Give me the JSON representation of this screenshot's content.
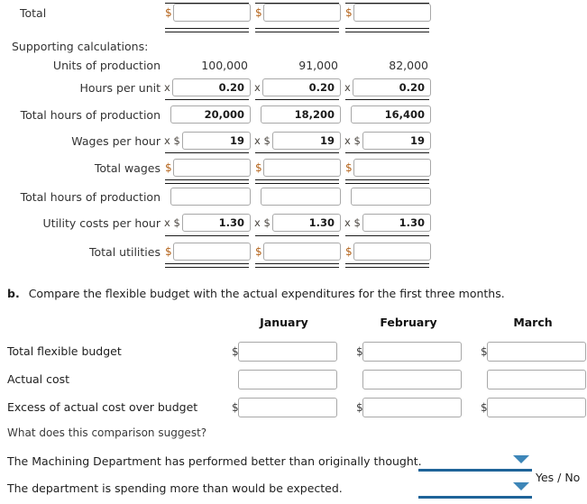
{
  "section_a": {
    "rows": [
      {
        "label": "Total",
        "label_style": "total",
        "cells": [
          {
            "type": "input",
            "prefix": "$",
            "value": ""
          },
          {
            "type": "input",
            "prefix": "$",
            "value": ""
          },
          {
            "type": "input",
            "prefix": "$",
            "value": ""
          }
        ]
      },
      {
        "label": "Supporting calculations:",
        "label_style": "section",
        "cells": [
          {
            "type": "empty"
          },
          {
            "type": "empty"
          },
          {
            "type": "empty"
          }
        ]
      },
      {
        "label": "Units of production",
        "label_style": "indent",
        "cells": [
          {
            "type": "text",
            "value": "100,000"
          },
          {
            "type": "text",
            "value": "91,000"
          },
          {
            "type": "text",
            "value": "82,000"
          }
        ]
      },
      {
        "label": "Hours per unit",
        "label_style": "indent",
        "cells": [
          {
            "type": "input",
            "prefix": "x",
            "value": "0.20"
          },
          {
            "type": "input",
            "prefix": "x",
            "value": "0.20"
          },
          {
            "type": "input",
            "prefix": "x",
            "value": "0.20"
          }
        ]
      },
      {
        "label": "Total hours of production",
        "label_style": "indent",
        "cells": [
          {
            "type": "input",
            "prefix": "",
            "value": "20,000"
          },
          {
            "type": "input",
            "prefix": "",
            "value": "18,200"
          },
          {
            "type": "input",
            "prefix": "",
            "value": "16,400"
          }
        ]
      },
      {
        "label": "Wages per hour",
        "label_style": "indent",
        "cells": [
          {
            "type": "input",
            "prefix": "x $",
            "value": "19"
          },
          {
            "type": "input",
            "prefix": "x $",
            "value": "19"
          },
          {
            "type": "input",
            "prefix": "x $",
            "value": "19"
          }
        ]
      },
      {
        "label": "Total wages",
        "label_style": "indent2",
        "cells": [
          {
            "type": "input",
            "prefix": "$",
            "value": ""
          },
          {
            "type": "input",
            "prefix": "$",
            "value": ""
          },
          {
            "type": "input",
            "prefix": "$",
            "value": ""
          }
        ]
      },
      {
        "label": "Total hours of production",
        "label_style": "indent",
        "cells": [
          {
            "type": "input",
            "prefix": "",
            "value": ""
          },
          {
            "type": "input",
            "prefix": "",
            "value": ""
          },
          {
            "type": "input",
            "prefix": "",
            "value": ""
          }
        ]
      },
      {
        "label": "Utility costs per hour",
        "label_style": "indent",
        "cells": [
          {
            "type": "input",
            "prefix": "x $",
            "value": "1.30"
          },
          {
            "type": "input",
            "prefix": "x $",
            "value": "1.30"
          },
          {
            "type": "input",
            "prefix": "x $",
            "value": "1.30"
          }
        ]
      },
      {
        "label": "Total utilities",
        "label_style": "indent2",
        "cells": [
          {
            "type": "input",
            "prefix": "$",
            "value": ""
          },
          {
            "type": "input",
            "prefix": "$",
            "value": ""
          },
          {
            "type": "input",
            "prefix": "$",
            "value": ""
          }
        ]
      }
    ]
  },
  "section_b": {
    "marker": "b.",
    "prompt": "Compare the flexible budget with the actual expenditures for the first three months.",
    "columns": [
      "January",
      "February",
      "March"
    ],
    "rows": [
      {
        "label": "Total flexible budget",
        "cells": [
          {
            "prefix": "$",
            "value": ""
          },
          {
            "prefix": "$",
            "value": ""
          },
          {
            "prefix": "$",
            "value": ""
          }
        ]
      },
      {
        "label": "Actual cost",
        "cells": [
          {
            "prefix": "",
            "value": ""
          },
          {
            "prefix": "",
            "value": ""
          },
          {
            "prefix": "",
            "value": ""
          }
        ]
      },
      {
        "label": "Excess of actual cost over budget",
        "cells": [
          {
            "prefix": "$",
            "value": ""
          },
          {
            "prefix": "$",
            "value": ""
          },
          {
            "prefix": "$",
            "value": ""
          }
        ]
      }
    ],
    "question": "What does this comparison suggest?",
    "statements": [
      {
        "text": "The Machining Department has performed better than originally thought.",
        "selected": ""
      },
      {
        "text": "The department is spending more than would be expected.",
        "selected": ""
      }
    ],
    "options_label": "Yes / No"
  },
  "colors": {
    "dropdown_line": "#1f6499",
    "dropdown_arrow": "#3d86b8",
    "input_border": "#a8a8a8",
    "rule": "#1a1a1a"
  }
}
